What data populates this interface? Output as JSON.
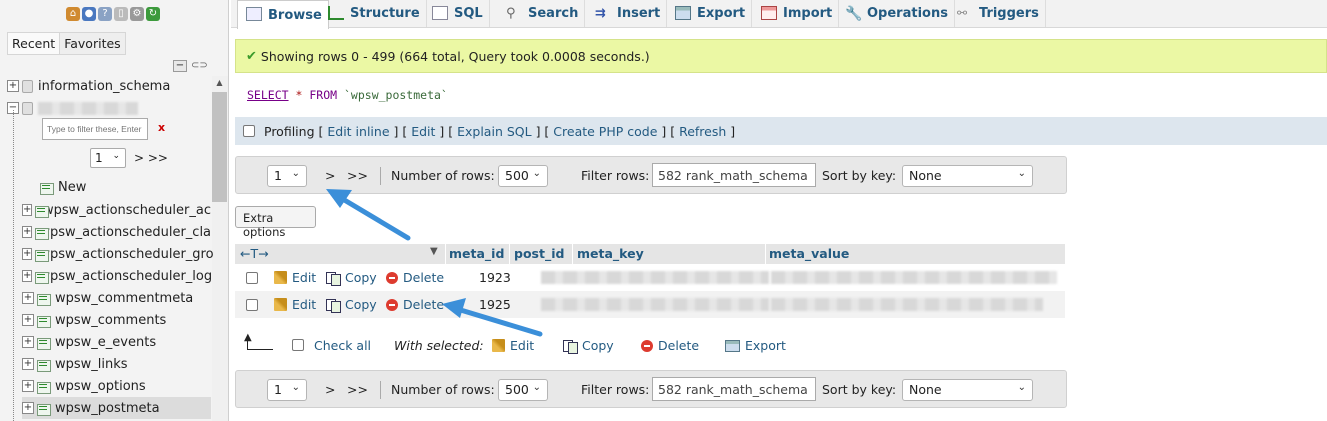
{
  "sidebar": {
    "tabs": [
      {
        "label": "Recent"
      },
      {
        "label": "Favorites"
      }
    ],
    "filter_placeholder": "Type to filter these, Enter",
    "filter_clear": "x",
    "page_select": "1",
    "page_next": "> >>",
    "databases": [
      {
        "label": "information_schema"
      }
    ],
    "new_label": "New",
    "tables": [
      {
        "label": "wpsw_actionscheduler_ac"
      },
      {
        "label": "wpsw_actionscheduler_cla"
      },
      {
        "label": "wpsw_actionscheduler_gro"
      },
      {
        "label": "wpsw_actionscheduler_log"
      },
      {
        "label": "wpsw_commentmeta"
      },
      {
        "label": "wpsw_comments"
      },
      {
        "label": "wpsw_e_events"
      },
      {
        "label": "wpsw_links"
      },
      {
        "label": "wpsw_options"
      },
      {
        "label": "wpsw_postmeta"
      }
    ]
  },
  "tabs": [
    {
      "label": "Browse"
    },
    {
      "label": "Structure"
    },
    {
      "label": "SQL"
    },
    {
      "label": "Search"
    },
    {
      "label": "Insert"
    },
    {
      "label": "Export"
    },
    {
      "label": "Import"
    },
    {
      "label": "Operations"
    },
    {
      "label": "Triggers"
    }
  ],
  "message": "Showing rows 0 - 499 (664 total, Query took 0.0008 seconds.)",
  "sql": {
    "select": "SELECT",
    "star": "*",
    "from": "FROM",
    "table": "`wpsw_postmeta`"
  },
  "profiling": {
    "label": "Profiling",
    "links": [
      "Edit inline",
      "Edit",
      "Explain SQL",
      "Create PHP code",
      "Refresh"
    ]
  },
  "nav": {
    "page": "1",
    "next": ">",
    "last": ">>",
    "rows_label": "Number of rows:",
    "rows_value": "500",
    "filter_label": "Filter rows:",
    "filter_value": "582 rank_math_schema",
    "sort_label": "Sort by key:",
    "sort_value": "None"
  },
  "extra_options": "Extra options",
  "table": {
    "sort_arrows": "←T→",
    "columns": [
      "meta_id",
      "post_id",
      "meta_key",
      "meta_value"
    ],
    "rows": [
      {
        "meta_id": "1923"
      },
      {
        "meta_id": "1925"
      }
    ],
    "actions": {
      "edit": "Edit",
      "copy": "Copy",
      "delete": "Delete"
    }
  },
  "bulk": {
    "check_all": "Check all",
    "with_selected": "With selected:",
    "edit": "Edit",
    "copy": "Copy",
    "delete": "Delete",
    "export": "Export"
  },
  "colors": {
    "link": "#235a81",
    "success_bg": "#ebf8a4",
    "arrow": "#3b8fd9"
  }
}
